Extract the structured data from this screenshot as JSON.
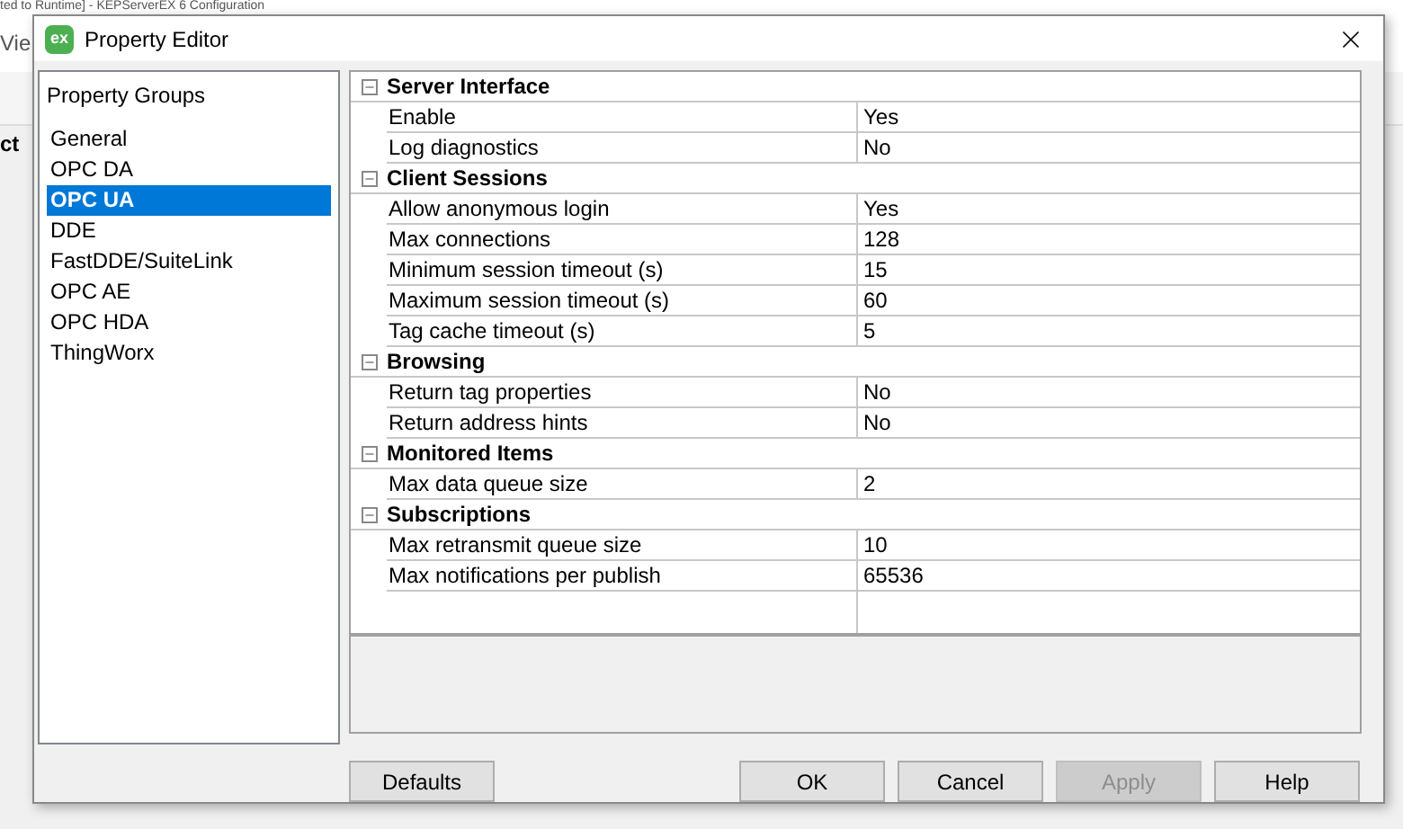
{
  "background_window": {
    "title": "ted to Runtime] - KEPServerEX 6 Configuration",
    "menu_fragment": "Vie",
    "panel_fragment": "ct"
  },
  "window": {
    "logo_text": "ex",
    "title": "Property Editor"
  },
  "sidebar": {
    "heading": "Property Groups",
    "items": [
      {
        "label": "General",
        "selected": false
      },
      {
        "label": "OPC DA",
        "selected": false
      },
      {
        "label": "OPC UA",
        "selected": true
      },
      {
        "label": "DDE",
        "selected": false
      },
      {
        "label": "FastDDE/SuiteLink",
        "selected": false
      },
      {
        "label": "OPC AE",
        "selected": false
      },
      {
        "label": "OPC HDA",
        "selected": false
      },
      {
        "label": "ThingWorx",
        "selected": false
      }
    ]
  },
  "grid": {
    "categories": [
      {
        "name": "Server Interface",
        "expanded": true,
        "properties": [
          {
            "name": "Enable",
            "value": "Yes"
          },
          {
            "name": "Log diagnostics",
            "value": "No"
          }
        ]
      },
      {
        "name": "Client Sessions",
        "expanded": true,
        "properties": [
          {
            "name": "Allow anonymous login",
            "value": "Yes"
          },
          {
            "name": "Max connections",
            "value": "128"
          },
          {
            "name": "Minimum session timeout (s)",
            "value": "15"
          },
          {
            "name": "Maximum session timeout (s)",
            "value": "60"
          },
          {
            "name": "Tag cache timeout (s)",
            "value": "5"
          }
        ]
      },
      {
        "name": "Browsing",
        "expanded": true,
        "properties": [
          {
            "name": "Return tag properties",
            "value": "No"
          },
          {
            "name": "Return address hints",
            "value": "No"
          }
        ]
      },
      {
        "name": "Monitored Items",
        "expanded": true,
        "properties": [
          {
            "name": "Max data queue size",
            "value": "2"
          }
        ]
      },
      {
        "name": "Subscriptions",
        "expanded": true,
        "properties": [
          {
            "name": "Max retransmit queue size",
            "value": "10"
          },
          {
            "name": "Max notifications per publish",
            "value": "65536"
          }
        ]
      }
    ]
  },
  "buttons": [
    {
      "label": "Defaults",
      "disabled": false
    },
    {
      "label": "OK",
      "disabled": false
    },
    {
      "label": "Cancel",
      "disabled": false
    },
    {
      "label": "Apply",
      "disabled": true
    },
    {
      "label": "Help",
      "disabled": false
    }
  ]
}
